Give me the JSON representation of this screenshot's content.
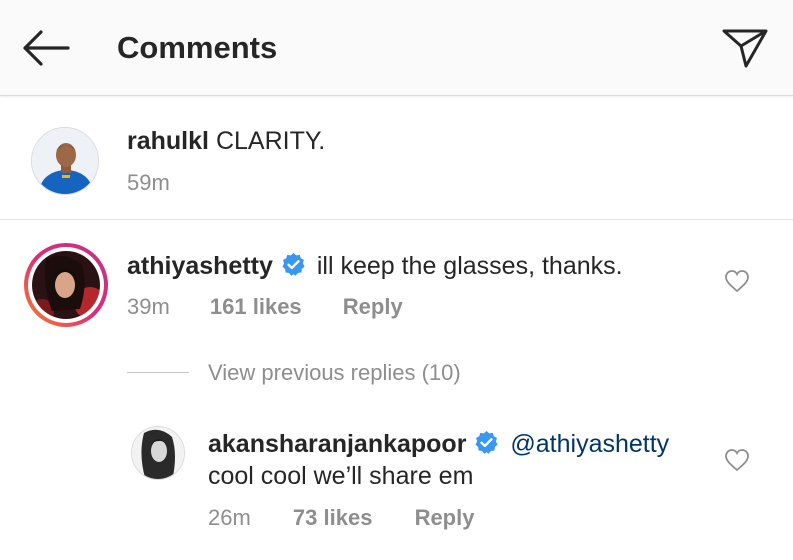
{
  "header": {
    "title": "Comments",
    "back_icon": "arrow-left-icon",
    "send_icon": "send-direct-icon"
  },
  "caption": {
    "username": "rahulkl",
    "text": "CLARITY.",
    "time": "59m"
  },
  "comment": {
    "username": "athiyashetty",
    "text": "ill keep the glasses, thanks.",
    "time": "39m",
    "likes": "161 likes",
    "reply_label": "Reply"
  },
  "view_replies": "View previous replies (10)",
  "reply": {
    "username": "akansharanjankapoor",
    "mention": "@athiyashetty",
    "text": "cool cool we’ll share em",
    "time": "26m",
    "likes": "73 likes",
    "reply_label": "Reply"
  },
  "colors": {
    "verified_blue": "#3897f0",
    "mention_blue": "#003569",
    "muted_gray": "#8e8e8e",
    "story_ring_start": "#f58529",
    "story_ring_end": "#c13584"
  }
}
